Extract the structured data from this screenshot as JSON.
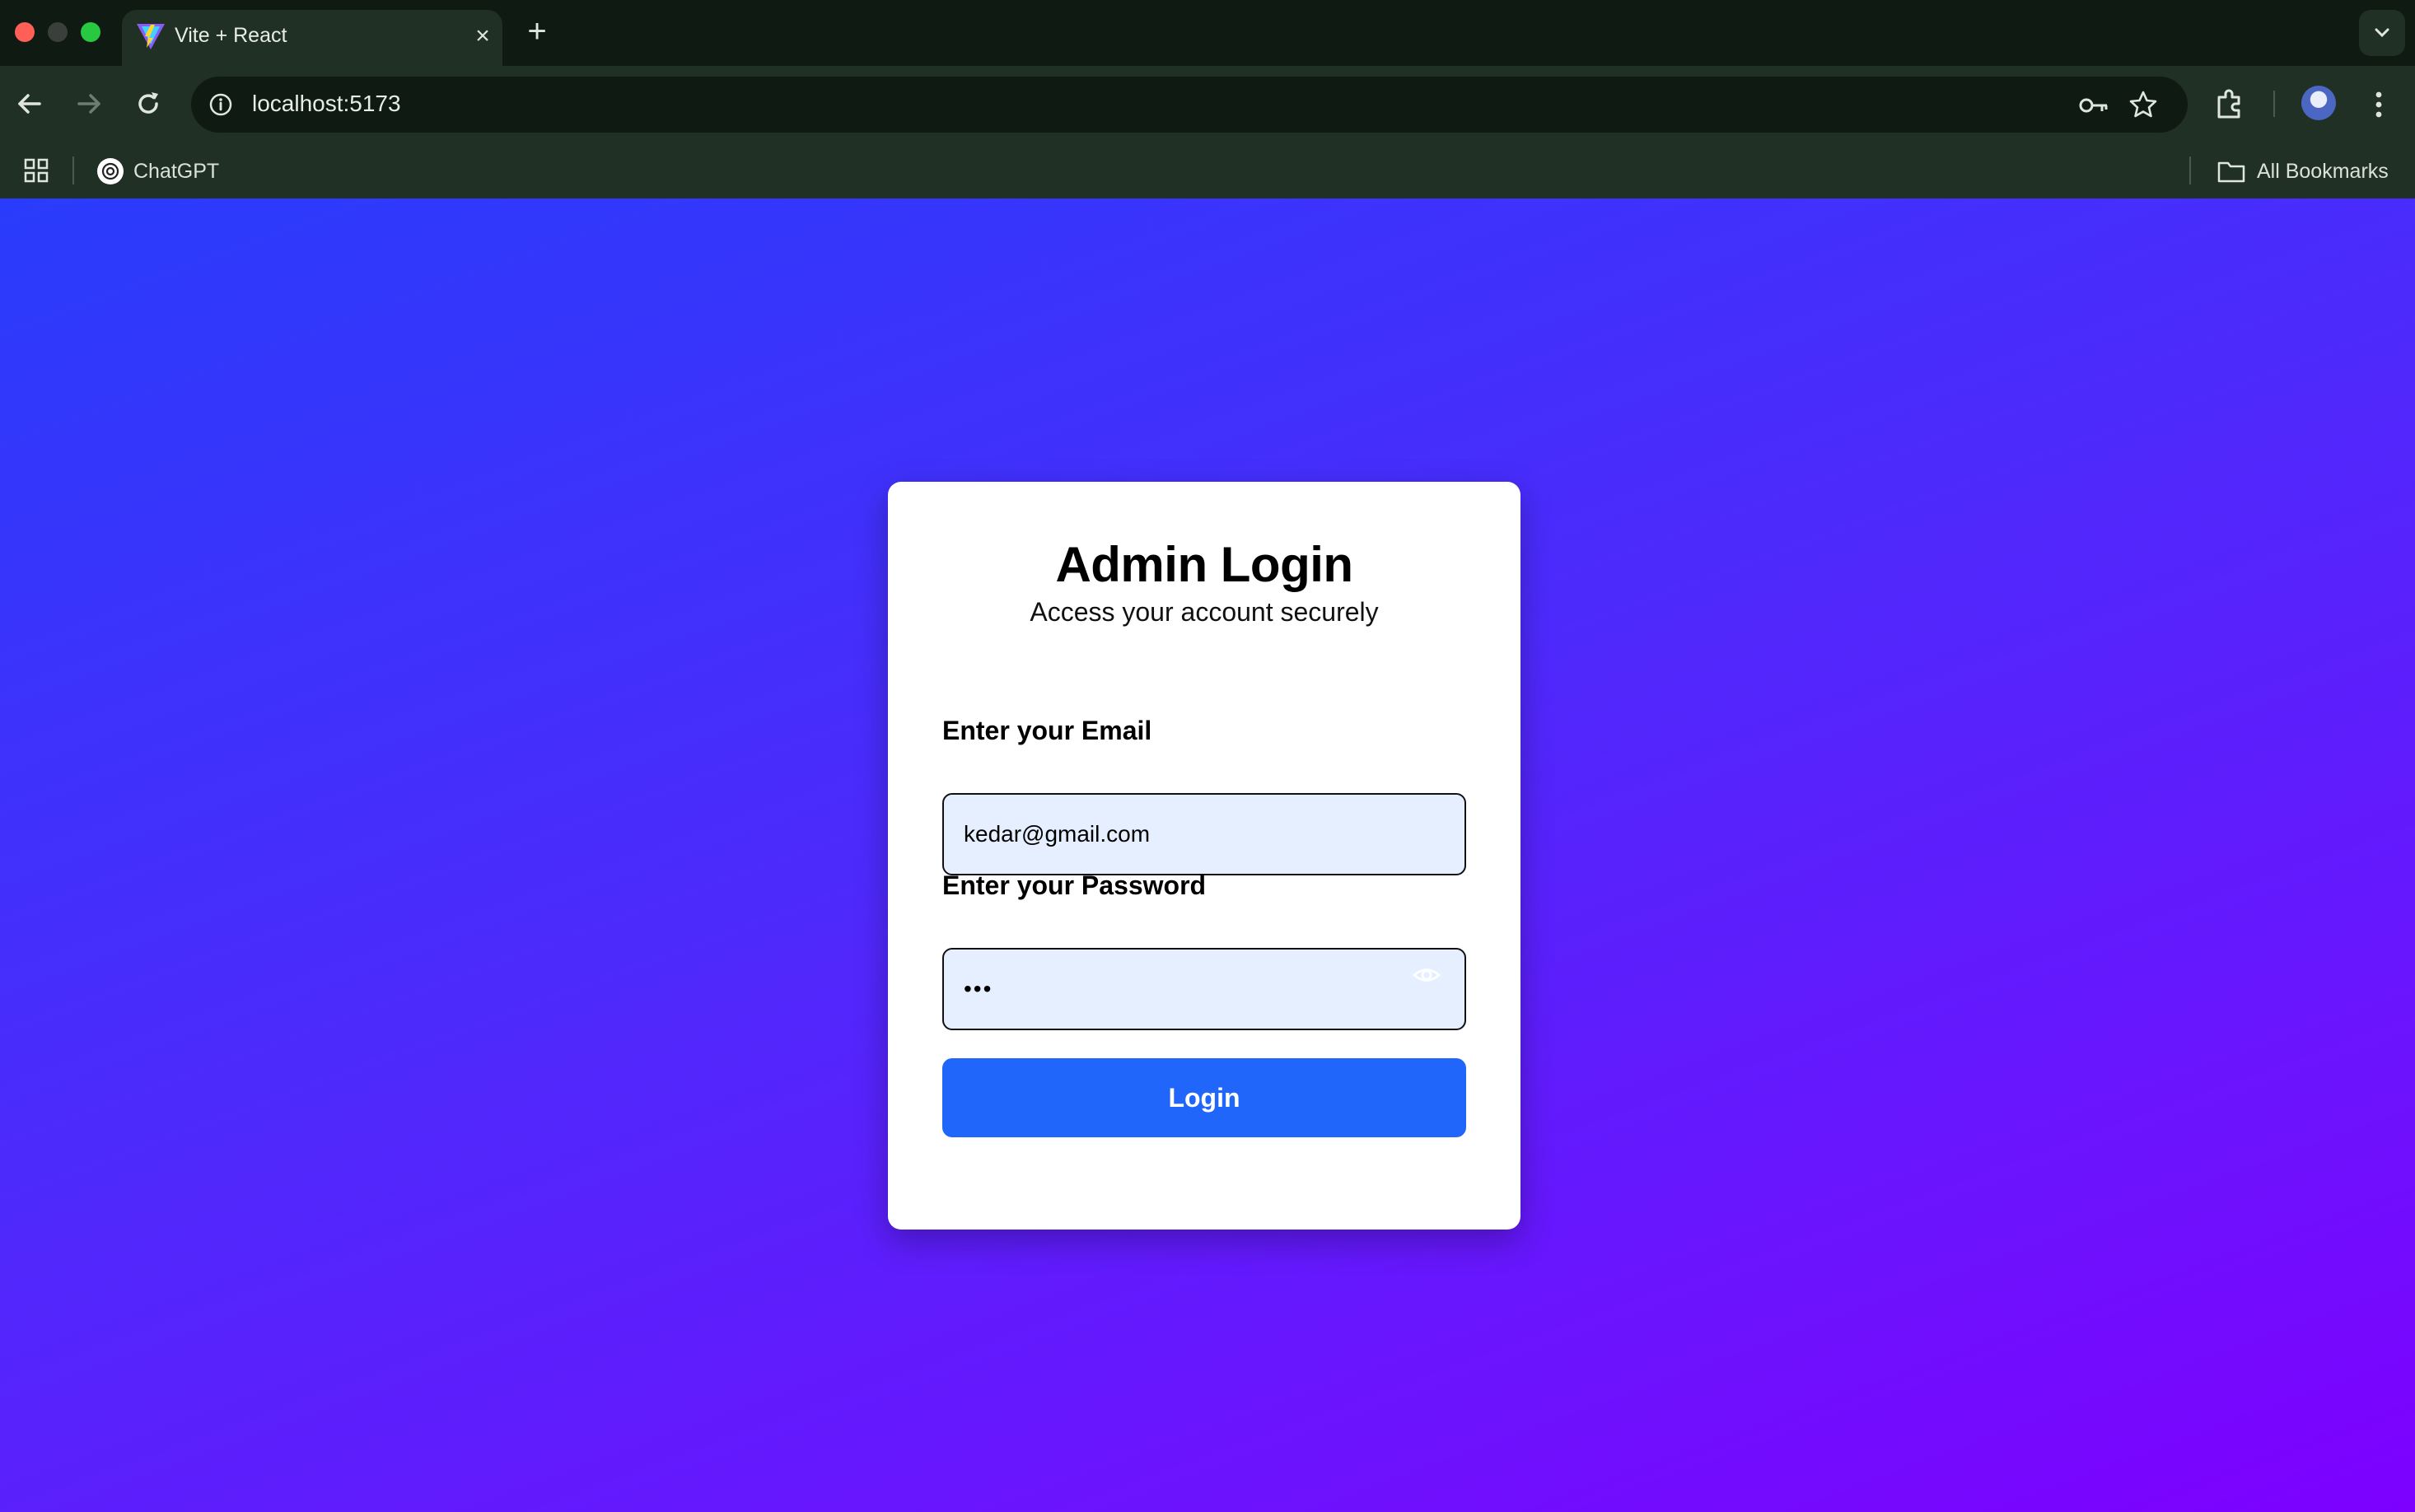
{
  "browser": {
    "tab": {
      "title": "Vite + React",
      "close_glyph": "×",
      "favicon": "vite-logo-icon"
    },
    "new_tab_glyph": "+",
    "address_bar": {
      "url": "localhost:5173"
    },
    "bookmarks": [
      {
        "label": "ChatGPT",
        "icon": "chatgpt-icon"
      }
    ],
    "all_bookmarks_label": "All Bookmarks"
  },
  "login": {
    "title": "Admin Login",
    "subtitle": "Access your account securely",
    "email_label": "Enter your Email",
    "email_value": "kedar@gmail.com",
    "password_label": "Enter your Password",
    "password_value": "•••",
    "button_label": "Login"
  },
  "colors": {
    "accent_button": "#2066fb",
    "input_bg": "#e6efff",
    "gradient_start": "#2a3cfb",
    "gradient_end": "#7d00ff"
  }
}
